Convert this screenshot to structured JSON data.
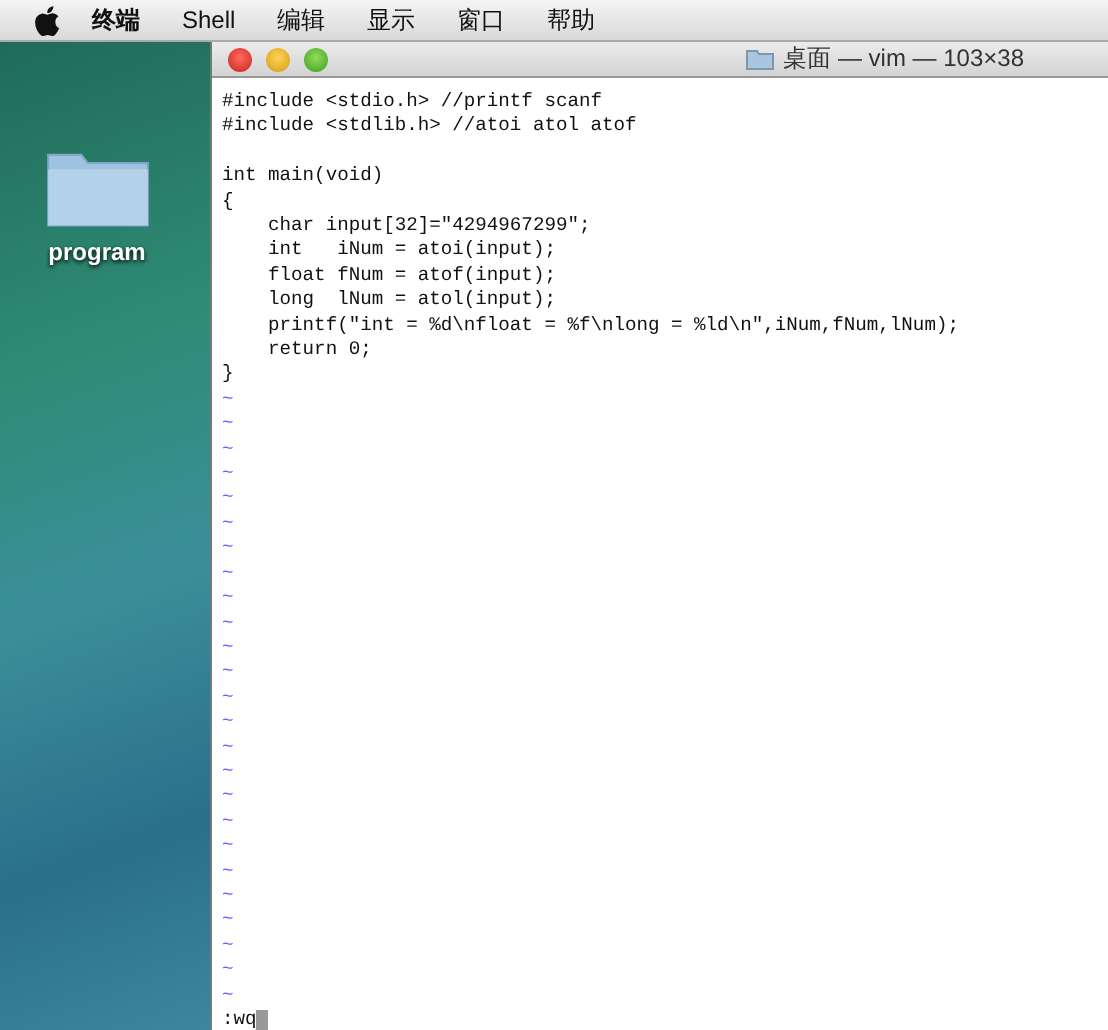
{
  "menu_bar": {
    "items": [
      {
        "label": "终端",
        "kind": "app"
      },
      {
        "label": "Shell",
        "kind": "menu"
      },
      {
        "label": "编辑",
        "kind": "menu"
      },
      {
        "label": "显示",
        "kind": "menu"
      },
      {
        "label": "窗口",
        "kind": "menu"
      },
      {
        "label": "帮助",
        "kind": "menu"
      }
    ]
  },
  "desktop": {
    "icons": [
      {
        "label": "program"
      }
    ]
  },
  "window": {
    "title": "桌面 — vim — 103×38",
    "code_blocks": [
      [
        "#include <stdio.h> //printf scanf",
        "#include <stdlib.h> //atoi atol atof"
      ],
      [
        "int main(void)",
        "{",
        "    char input[32]=\"4294967299\";",
        "    int   iNum = atoi(input);",
        "    float fNum = atof(input);",
        "    long  lNum = atol(input);",
        "    printf(\"int = %d\\nfloat = %f\\nlong = %ld\\n\",iNum,fNum,lNum);",
        "    return 0;",
        "}"
      ]
    ],
    "tildes": [
      "~",
      "~",
      "~",
      "~",
      "~",
      "~",
      "~",
      "~",
      "~",
      "~",
      "~",
      "~",
      "~",
      "~",
      "~",
      "~",
      "~",
      "~",
      "~",
      "~",
      "~",
      "~",
      "~",
      "~",
      "~"
    ],
    "command_line": ":wq"
  }
}
